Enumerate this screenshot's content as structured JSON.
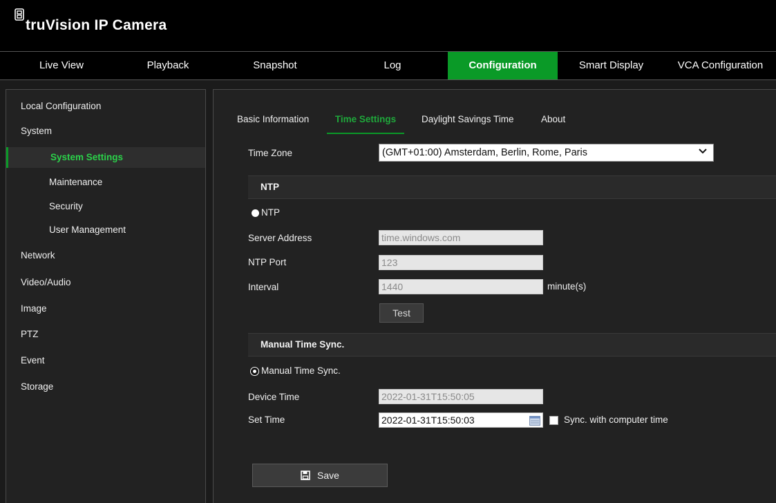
{
  "app": {
    "title": "truVision IP Camera"
  },
  "nav": {
    "tabs": [
      {
        "label": "Live View"
      },
      {
        "label": "Playback"
      },
      {
        "label": "Snapshot"
      },
      {
        "label": "Log"
      },
      {
        "label": "Configuration",
        "active": true
      },
      {
        "label": "Smart Display"
      },
      {
        "label": "VCA Configuration"
      }
    ]
  },
  "sidebar": {
    "items": [
      {
        "label": "Local Configuration"
      },
      {
        "label": "System"
      },
      {
        "label": "System Settings",
        "active": true
      },
      {
        "label": "Maintenance"
      },
      {
        "label": "Security"
      },
      {
        "label": "User Management"
      },
      {
        "label": "Network"
      },
      {
        "label": "Video/Audio"
      },
      {
        "label": "Image"
      },
      {
        "label": "PTZ"
      },
      {
        "label": "Event"
      },
      {
        "label": "Storage"
      }
    ]
  },
  "subtabs": [
    {
      "label": "Basic Information"
    },
    {
      "label": "Time Settings",
      "active": true
    },
    {
      "label": "Daylight Savings Time"
    },
    {
      "label": "About"
    }
  ],
  "time_zone": {
    "label": "Time Zone",
    "value": "(GMT+01:00) Amsterdam, Berlin, Rome, Paris"
  },
  "ntp": {
    "section_title": "NTP",
    "radio_label": "NTP",
    "server_address": {
      "label": "Server Address",
      "value": "time.windows.com"
    },
    "port": {
      "label": "NTP Port",
      "value": "123"
    },
    "interval": {
      "label": "Interval",
      "value": "1440",
      "unit": "minute(s)"
    },
    "test_label": "Test"
  },
  "manual": {
    "section_title": "Manual Time Sync.",
    "radio_label": "Manual Time Sync.",
    "device_time": {
      "label": "Device Time",
      "value": "2022-01-31T15:50:05"
    },
    "set_time": {
      "label": "Set Time",
      "value": "2022-01-31T15:50:03"
    },
    "sync_label": "Sync. with computer time"
  },
  "save_label": "Save",
  "colors": {
    "accent": "#0a9a27",
    "background": "#222222",
    "header": "#000000"
  },
  "icons": [
    "logo-icon",
    "chevron-down-icon",
    "calendar-icon",
    "save-icon"
  ]
}
